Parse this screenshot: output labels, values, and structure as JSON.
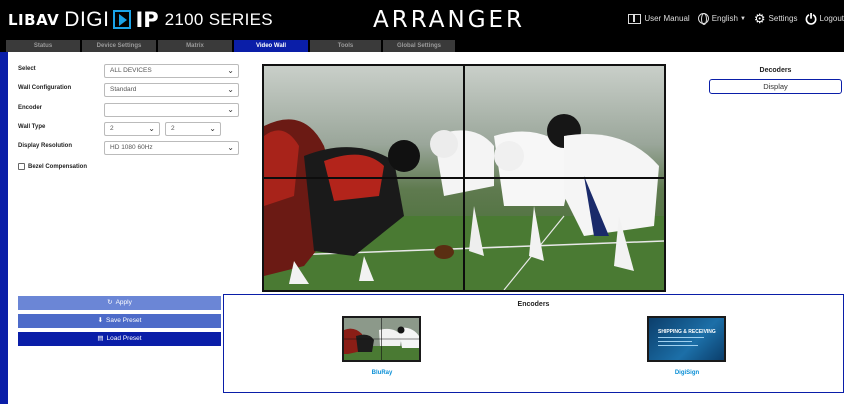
{
  "header": {
    "brand_libav": "LIBAV",
    "brand_digi": "DIGI",
    "brand_ip": "IP",
    "brand_series": "2100 SERIES",
    "app_title": "ARRANGER",
    "user_manual": "User Manual",
    "language": "English",
    "settings": "Settings",
    "logout": "Logout"
  },
  "tabs": [
    {
      "label": "Status",
      "active": false
    },
    {
      "label": "Device Settings",
      "active": false
    },
    {
      "label": "Matrix",
      "active": false
    },
    {
      "label": "Video Wall",
      "active": true
    },
    {
      "label": "Tools",
      "active": false
    },
    {
      "label": "Global Settings",
      "active": false
    }
  ],
  "form": {
    "select_label": "Select",
    "select_value": "ALL DEVICES",
    "wall_config_label": "Wall Configuration",
    "wall_config_value": "Standard",
    "encoder_label": "Encoder",
    "encoder_value": "",
    "wall_type_label": "Wall Type",
    "wall_type_cols": "2",
    "wall_type_rows": "2",
    "display_res_label": "Display Resolution",
    "display_res_value": "HD 1080 60Hz",
    "bezel_label": "Bezel Compensation",
    "bezel_checked": false
  },
  "decoders": {
    "title": "Decoders",
    "display_label": "Display"
  },
  "actions": {
    "apply": "Apply",
    "save_preset": "Save Preset",
    "load_preset": "Load Preset"
  },
  "encoders": {
    "title": "Encoders",
    "items": [
      {
        "name": "BluRay"
      },
      {
        "name": "DigiSign",
        "thumb_text": "SHIPPING & RECEIVING"
      }
    ]
  },
  "colors": {
    "accent": "#0a1ea8",
    "header_bg": "#000000",
    "tab_bg": "#3a3a3a",
    "encoder_label": "#0a8fd6"
  }
}
